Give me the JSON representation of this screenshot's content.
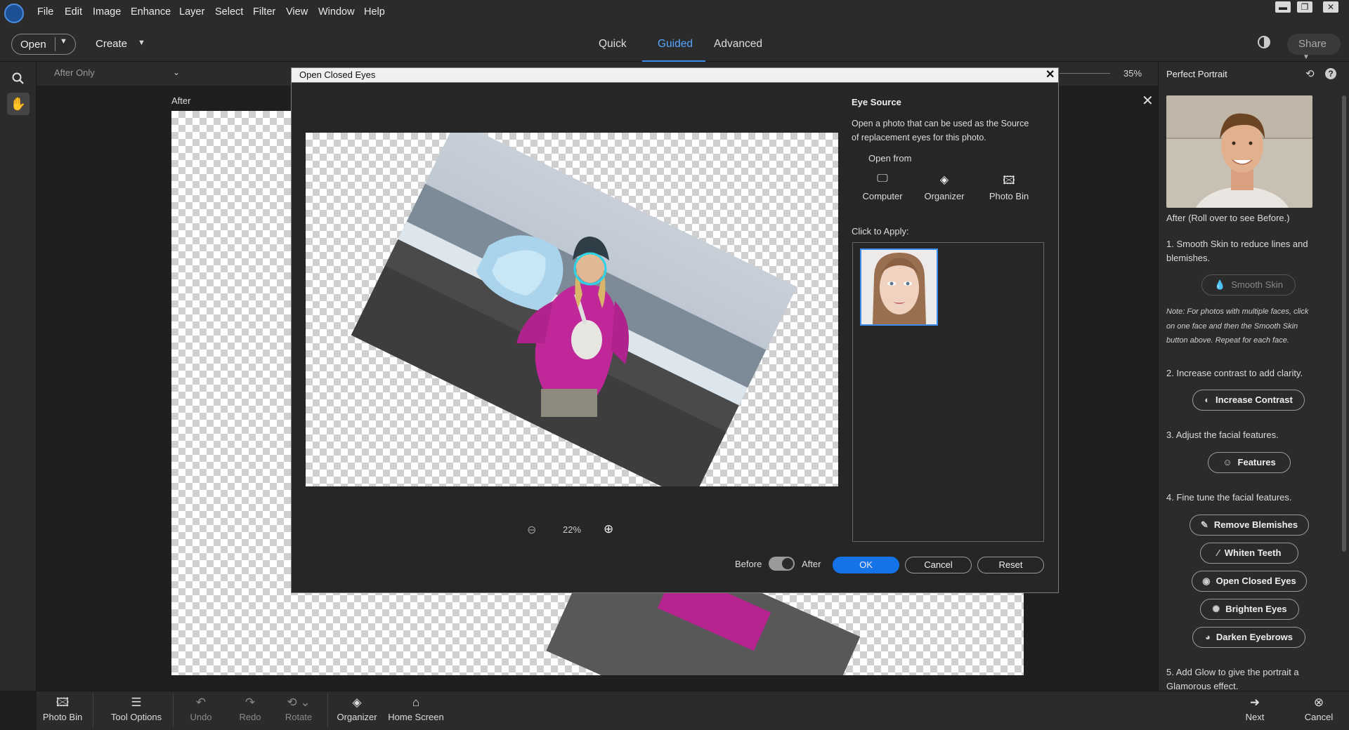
{
  "menubar": {
    "items": [
      "File",
      "Edit",
      "Image",
      "Enhance",
      "Layer",
      "Select",
      "Filter",
      "View",
      "Window",
      "Help"
    ],
    "window_controls": {
      "minimize": "▬",
      "restore": "❐",
      "close": "✕"
    }
  },
  "toolbar": {
    "open_label": "Open",
    "create_label": "Create",
    "modes": [
      "Quick",
      "Guided",
      "Advanced"
    ],
    "active_mode": "Guided",
    "share_label": "Share"
  },
  "options": {
    "view_mode": "After Only",
    "zoom_percent": "35%"
  },
  "workspace": {
    "after_label": "After"
  },
  "panel": {
    "title": "Perfect Portrait",
    "photo_caption": "After (Roll over to see Before.)",
    "step1": "1. Smooth Skin to reduce lines and blemishes.",
    "smooth_skin": "Smooth Skin",
    "note": "Note: For photos with multiple faces, click on one face and then the Smooth Skin button above. Repeat for each face.",
    "step2": "2. Increase contrast to add clarity.",
    "increase_contrast": "Increase Contrast",
    "step3": "3. Adjust the facial features.",
    "features": "Features",
    "step4": "4. Fine tune the facial features.",
    "remove_blemishes": "Remove Blemishes",
    "whiten_teeth": "Whiten Teeth",
    "open_closed_eyes": "Open Closed Eyes",
    "brighten_eyes": "Brighten Eyes",
    "darken_eyebrows": "Darken Eyebrows",
    "step5": "5. Add Glow to give the portrait a Glamorous effect."
  },
  "dialog": {
    "title": "Open Closed Eyes",
    "zoom": "22%",
    "eye_source_title": "Eye Source",
    "eye_source_desc": "Open a photo that can be used as the Source of replacement eyes for this photo.",
    "open_from": "Open from",
    "sources": [
      "Computer",
      "Organizer",
      "Photo Bin"
    ],
    "click_to_apply": "Click to Apply:",
    "before": "Before",
    "after": "After",
    "toggle_on_after": true,
    "ok": "OK",
    "cancel": "Cancel",
    "reset": "Reset"
  },
  "bottombar": {
    "photo_bin": "Photo Bin",
    "tool_options": "Tool Options",
    "undo": "Undo",
    "redo": "Redo",
    "rotate": "Rotate",
    "organizer": "Organizer",
    "home_screen": "Home Screen",
    "next": "Next",
    "cancel": "Cancel"
  },
  "colors": {
    "accent": "#1473e6",
    "active_tab": "#56a6ff",
    "eye_circle": "#2fd3e8",
    "jacket": "#c0289a"
  }
}
